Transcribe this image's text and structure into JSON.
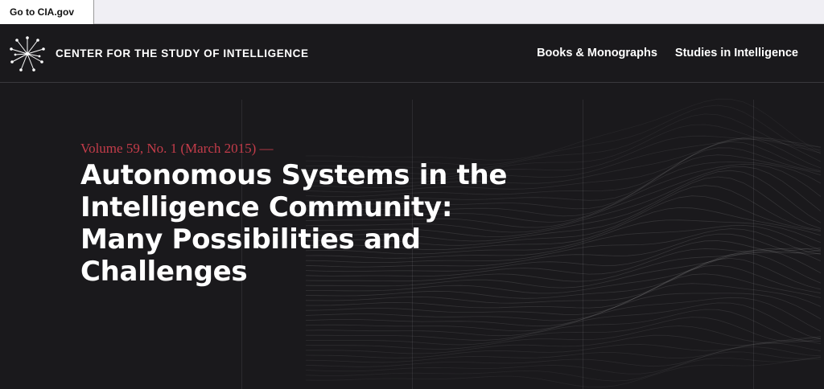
{
  "topbar": {
    "cia_link": "Go to CIA.gov"
  },
  "header": {
    "site_title": "CENTER FOR THE STUDY OF INTELLIGENCE",
    "nav": [
      {
        "label": "Books & Monographs"
      },
      {
        "label": "Studies in Intelligence"
      }
    ]
  },
  "hero": {
    "kicker": "Volume 59, No. 1 (March 2015) —",
    "title": "Autonomous Systems in the Intelligence Community: Many Possibilities and Challenges"
  },
  "colors": {
    "background": "#1a191c",
    "accent": "#c43c4a",
    "text": "#ffffff"
  },
  "icons": {
    "logo": "starburst-logo-icon"
  }
}
